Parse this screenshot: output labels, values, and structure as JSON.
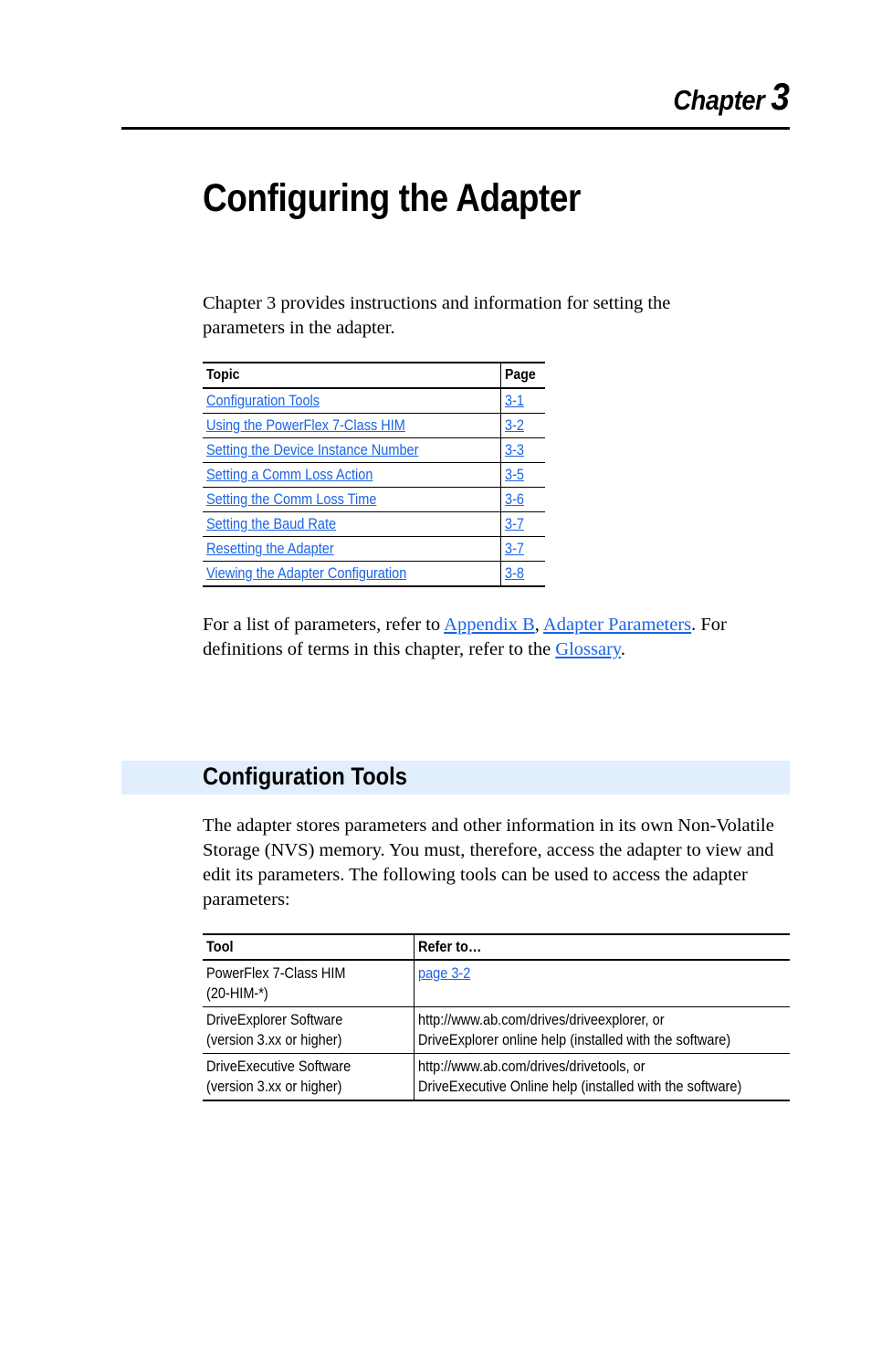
{
  "chapter": {
    "label": "Chapter",
    "number": "3"
  },
  "title": "Configuring the Adapter",
  "intro": "Chapter 3 provides instructions and information for setting the parameters in the adapter.",
  "topic_table": {
    "headers": {
      "topic": "Topic",
      "page": "Page"
    },
    "rows": [
      {
        "topic": "Configuration Tools",
        "page": "3-1"
      },
      {
        "topic": "Using the PowerFlex 7-Class HIM",
        "page": "3-2"
      },
      {
        "topic": "Setting the Device Instance Number",
        "page": "3-3"
      },
      {
        "topic": "Setting a Comm Loss Action",
        "page": "3-5"
      },
      {
        "topic": "Setting the Comm Loss Time",
        "page": "3-6"
      },
      {
        "topic": "Setting the Baud Rate",
        "page": "3-7"
      },
      {
        "topic": "Resetting the Adapter",
        "page": "3-7"
      },
      {
        "topic": "Viewing the Adapter Configuration",
        "page": "3-8"
      }
    ]
  },
  "refs": {
    "text1": "For a list of parameters, refer to ",
    "link1": "Appendix B",
    "sep": ", ",
    "link2": "Adapter Parameters",
    "text2": ". For definitions of terms in this chapter, refer to the ",
    "link3": "Glossary",
    "text3": "."
  },
  "section": {
    "title": "Configuration Tools",
    "body": "The adapter stores parameters and other information in its own Non-Volatile Storage (NVS) memory. You must, therefore, access the adapter to view and edit its parameters. The following tools can be used to access the adapter parameters:"
  },
  "tool_table": {
    "headers": {
      "tool": "Tool",
      "refer": "Refer to…"
    },
    "rows": [
      {
        "tool_line1": "PowerFlex 7-Class HIM",
        "tool_line2": "(20-HIM-*)",
        "refer_link": "page 3-2"
      },
      {
        "tool_line1": "DriveExplorer Software",
        "tool_line2": "(version 3.xx or higher)",
        "refer_line1": "http://www.ab.com/drives/driveexplorer, or",
        "refer_line2": "DriveExplorer online help (installed with the software)"
      },
      {
        "tool_line1": "DriveExecutive Software",
        "tool_line2": "(version 3.xx or higher)",
        "refer_line1": "http://www.ab.com/drives/drivetools, or",
        "refer_line2": "DriveExecutive Online help (installed with the software)"
      }
    ]
  }
}
